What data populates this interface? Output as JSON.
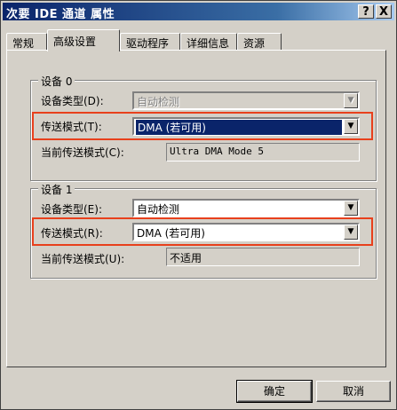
{
  "window": {
    "title": "次要 IDE 通道 属性",
    "help_btn": "?",
    "close_btn": "X"
  },
  "tabs": [
    {
      "label": "常规"
    },
    {
      "label": "高级设置",
      "active": true
    },
    {
      "label": "驱动程序"
    },
    {
      "label": "详细信息"
    },
    {
      "label": "资源"
    }
  ],
  "device0": {
    "group_label": "设备 0",
    "type_label": "设备类型(D):",
    "type_value": "自动检测",
    "mode_label": "传送模式(T):",
    "mode_value": "DMA (若可用)",
    "current_label": "当前传送模式(C):",
    "current_value": "Ultra DMA Mode 5"
  },
  "device1": {
    "group_label": "设备 1",
    "type_label": "设备类型(E):",
    "type_value": "自动检测",
    "mode_label": "传送模式(R):",
    "mode_value": "DMA (若可用)",
    "current_label": "当前传送模式(U):",
    "current_value": "不适用"
  },
  "buttons": {
    "ok": "确定",
    "cancel": "取消"
  },
  "colors": {
    "title_bar": "#0a246a",
    "highlight": "#e8401c",
    "face": "#d4d0c8"
  }
}
